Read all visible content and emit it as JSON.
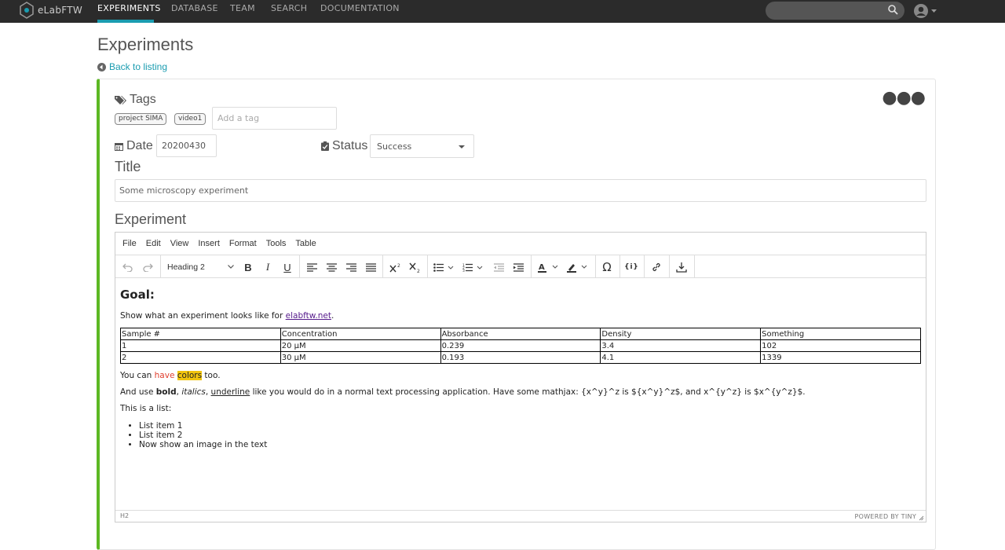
{
  "nav": {
    "brand": "eLabFTW",
    "items": [
      "EXPERIMENTS",
      "DATABASE",
      "TEAM",
      "SEARCH",
      "DOCUMENTATION"
    ],
    "accent": "#1a9cb0"
  },
  "page": {
    "title": "Experiments",
    "back": "Back to listing"
  },
  "card": {
    "tags_label": "Tags",
    "tags": [
      "project SIMA",
      "video1"
    ],
    "tag_placeholder": "Add a tag",
    "date_label": "Date",
    "date_value": "20200430",
    "status_label": "Status",
    "status_value": "Success",
    "title_label": "Title",
    "title_value": "Some microscopy experiment",
    "experiment_label": "Experiment",
    "border_color": "#5cb823"
  },
  "editor": {
    "menu": [
      "File",
      "Edit",
      "View",
      "Insert",
      "Format",
      "Tools",
      "Table"
    ],
    "block_format": "Heading 2",
    "status_path": "H2",
    "powered": "POWERED BY TINY",
    "content": {
      "heading": "Goal:",
      "intro_text": "Show what an experiment looks like for ",
      "intro_link": "elabftw.net",
      "intro_end": ".",
      "table": [
        [
          "Sample #",
          "Concentration",
          "Absorbance",
          "Density",
          "Something"
        ],
        [
          "1",
          "20 µM",
          "0.239",
          "3.4",
          "102"
        ],
        [
          "2",
          "30 µM",
          "0.193",
          "4.1",
          "1339"
        ]
      ],
      "colors_pre": "You can ",
      "colors_red": "have",
      "colors_hl": "colors",
      "colors_post": " too.",
      "fmt_pre": "And use ",
      "fmt_bold": "bold",
      "fmt_comma1": ", ",
      "fmt_italic": "italics",
      "fmt_comma2": ", ",
      "fmt_underline": "underline",
      "fmt_rest": " like you would do in a normal text processing application. Have some mathjax:   {x^y}^z is ${x^y}^z$, and x^{y^z} is $x^{y^z}$.",
      "list_intro": "This is a list:",
      "list": [
        "List item 1",
        "List item 2",
        "Now show an image in the text"
      ]
    }
  }
}
